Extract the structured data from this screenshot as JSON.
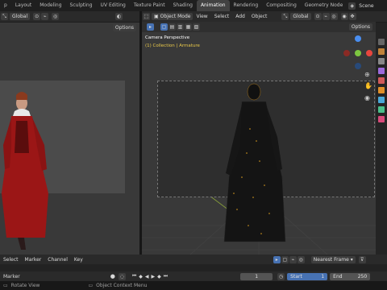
{
  "topbar": {
    "tabs": [
      {
        "label": "p"
      },
      {
        "label": "Layout"
      },
      {
        "label": "Modeling"
      },
      {
        "label": "Sculpting"
      },
      {
        "label": "UV Editing"
      },
      {
        "label": "Texture Paint"
      },
      {
        "label": "Shading"
      },
      {
        "label": "Animation"
      },
      {
        "label": "Rendering"
      },
      {
        "label": "Compositing"
      },
      {
        "label": "Geometry Node"
      }
    ],
    "active_tab": "Animation",
    "scene_label": "Scene"
  },
  "left_viewport": {
    "transform_label": "Global",
    "options_label": "Options"
  },
  "right_viewport": {
    "mode_label": "Object Mode",
    "menus": [
      "View",
      "Select",
      "Add",
      "Object"
    ],
    "transform_label": "Global",
    "options_label": "Options",
    "camera_label": "Camera Perspective",
    "collection_label": "(1) Collection | Armature",
    "gizmo": {
      "x_color": "#e8463e",
      "y_color": "#7cc640",
      "z_color": "#4a8ef0"
    }
  },
  "timeline": {
    "menus": [
      "Select",
      "Marker",
      "Channel",
      "Key"
    ],
    "interp_label": "Nearest Frame",
    "marker_label": "Marker",
    "current_frame": "1",
    "start_label": "Start",
    "start_value": "1",
    "end_label": "End",
    "end_value": "250"
  },
  "statusbar": {
    "left_hint": "Rotate View",
    "right_hint": "Object Context Menu"
  }
}
